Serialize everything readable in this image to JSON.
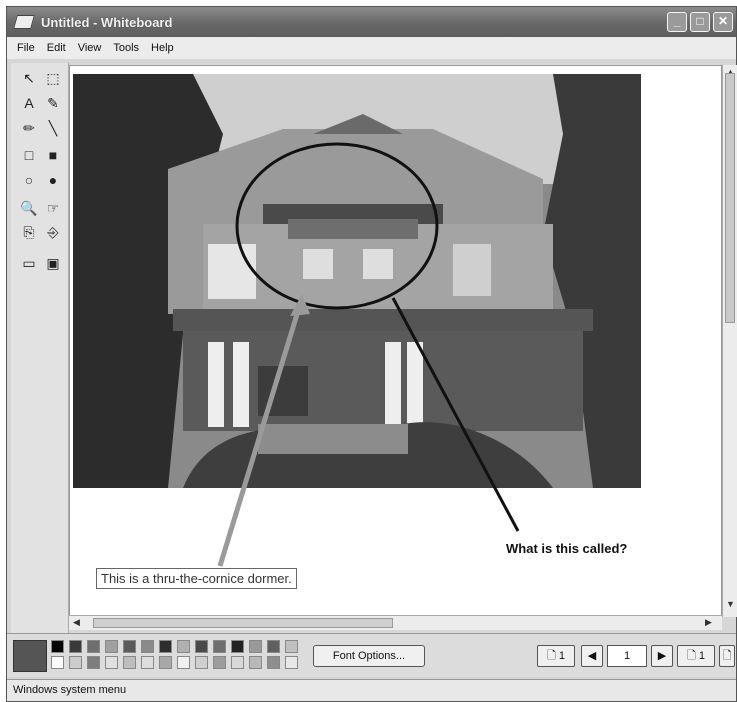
{
  "window": {
    "title": "Untitled - Whiteboard"
  },
  "menu": [
    "File",
    "Edit",
    "View",
    "Tools",
    "Help"
  ],
  "tools": [
    {
      "name": "select-arrow-icon",
      "glyph": "↖"
    },
    {
      "name": "select-area-icon",
      "glyph": "⬚"
    },
    {
      "name": "text-tool-icon",
      "glyph": "A"
    },
    {
      "name": "highlighter-icon",
      "glyph": "✎"
    },
    {
      "name": "pen-icon",
      "glyph": "✏"
    },
    {
      "name": "line-icon",
      "glyph": "╲"
    },
    {
      "name": "rectangle-icon",
      "glyph": "□"
    },
    {
      "name": "filled-rectangle-icon",
      "glyph": "■"
    },
    {
      "name": "ellipse-icon",
      "glyph": "○"
    },
    {
      "name": "filled-ellipse-icon",
      "glyph": "●"
    },
    {
      "name": "zoom-icon",
      "glyph": "🔍"
    },
    {
      "name": "remote-pointer-icon",
      "glyph": "☞"
    },
    {
      "name": "lock-contents-icon",
      "glyph": "⎘"
    },
    {
      "name": "synchronize-icon",
      "glyph": "⎆"
    },
    {
      "name": "select-window-icon",
      "glyph": "▭"
    },
    {
      "name": "select-area-capture-icon",
      "glyph": "▣"
    }
  ],
  "canvas": {
    "question_text": "What is this called?",
    "answer_text": "This is a thru-the-cornice dormer."
  },
  "bottombar": {
    "font_options_label": "Font Options...",
    "page_left_label": "1",
    "page_value": "1",
    "page_right_label": "1",
    "prev_glyph": "◀",
    "next_glyph": "▶",
    "active_color": "#555555"
  },
  "palette": [
    "#000000",
    "#3a3a3a",
    "#707070",
    "#a0a0a0",
    "#5a5a5a",
    "#8a8a8a",
    "#2e2e2e",
    "#b0b0b0",
    "#4a4a4a",
    "#6e6e6e",
    "#222222",
    "#999999",
    "#606060",
    "#c0c0c0",
    "#ffffff",
    "#cccccc",
    "#7d7d7d",
    "#e0e0e0",
    "#bdbdbd",
    "#dedede",
    "#a8a8a8",
    "#f0f0f0",
    "#cfcfcf",
    "#9d9d9d",
    "#d8d8d8",
    "#b8b8b8",
    "#8e8e8e",
    "#e8e8e8"
  ],
  "statusbar": {
    "text": "Windows system menu"
  }
}
